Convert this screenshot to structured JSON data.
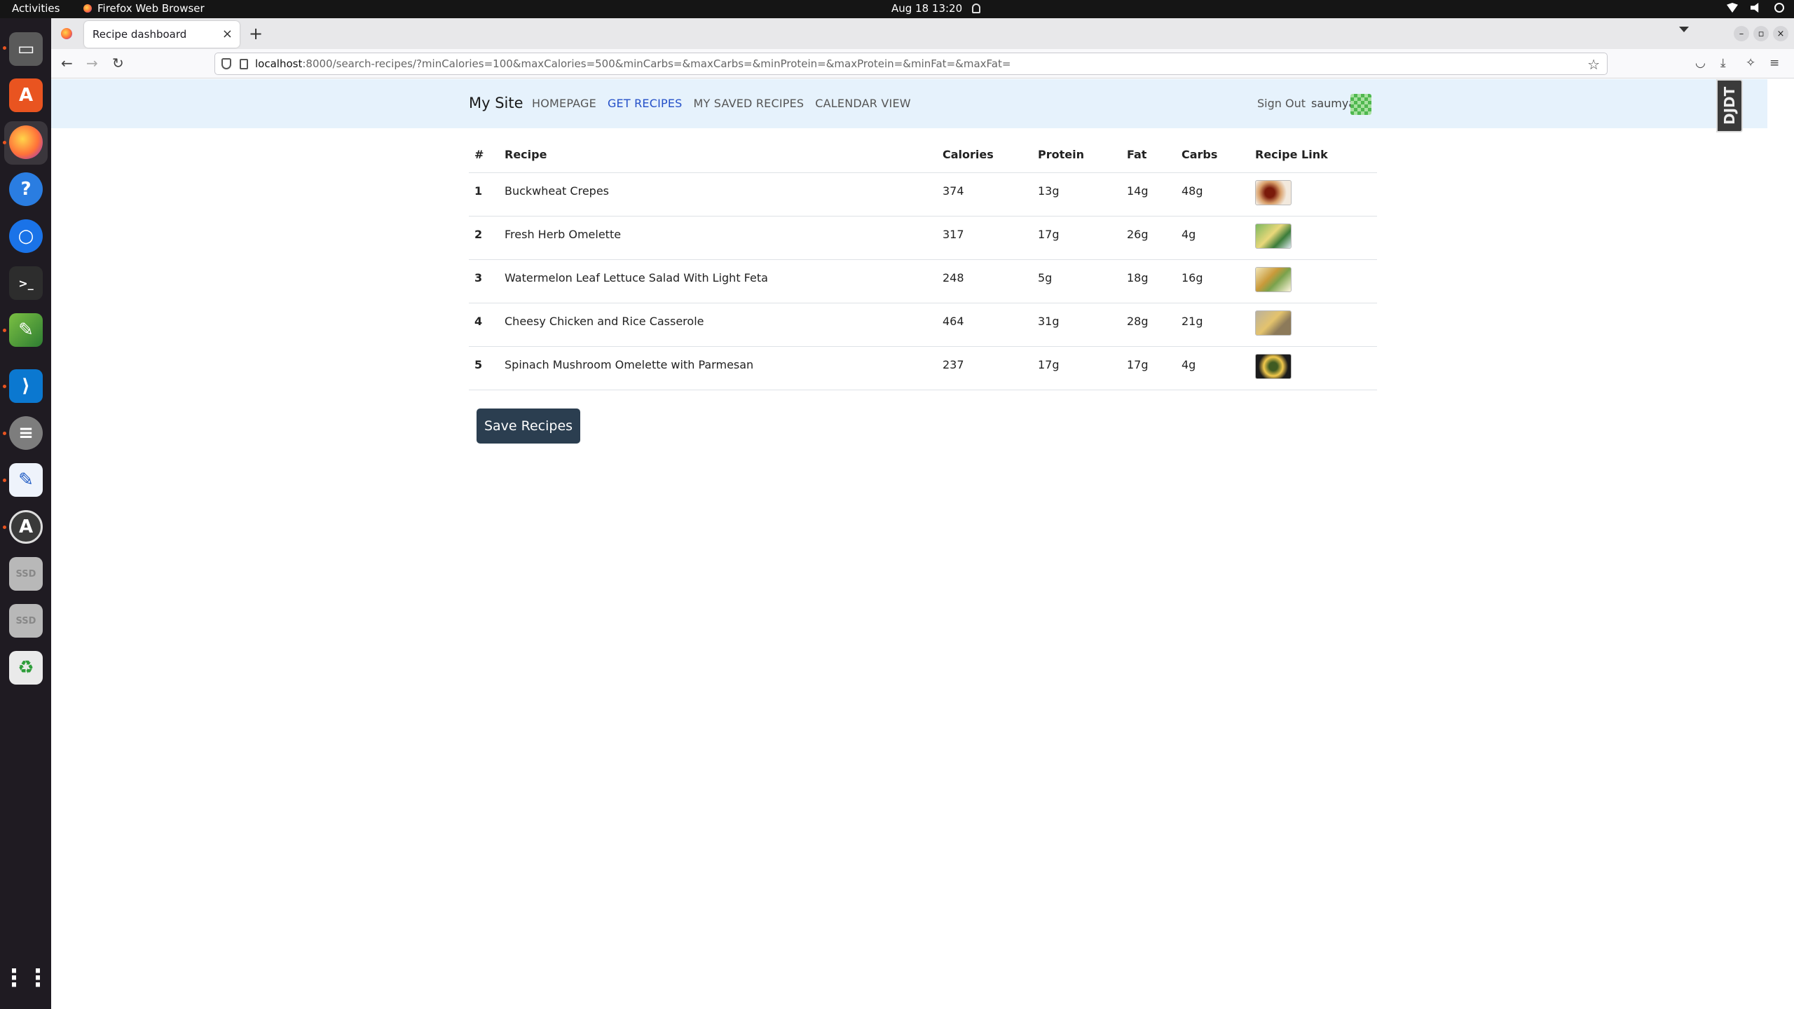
{
  "system": {
    "activities": "Activities",
    "app_name": "Firefox Web Browser",
    "clock": "Aug 18  13:20"
  },
  "browser": {
    "tab_title": "Recipe dashboard",
    "url_host": "localhost",
    "url_rest": ":8000/search-recipes/?minCalories=100&maxCalories=500&minCarbs=&maxCarbs=&minProtein=&maxProtein=&minFat=&maxFat="
  },
  "site": {
    "brand": "My Site",
    "nav": [
      "HOMEPAGE",
      "GET RECIPES",
      "MY SAVED RECIPES",
      "CALENDAR VIEW"
    ],
    "active_nav": "GET RECIPES",
    "sign_out": "Sign Out",
    "username": "saumya",
    "debug_toolbar": "DJDT"
  },
  "table": {
    "headers": [
      "#",
      "Recipe",
      "Calories",
      "Protein",
      "Fat",
      "Carbs",
      "Recipe Link"
    ],
    "rows": [
      {
        "num": "1",
        "recipe": "Buckwheat Crepes",
        "calories": "374",
        "protein": "13g",
        "fat": "14g",
        "carbs": "48g"
      },
      {
        "num": "2",
        "recipe": "Fresh Herb Omelette",
        "calories": "317",
        "protein": "17g",
        "fat": "26g",
        "carbs": "4g"
      },
      {
        "num": "3",
        "recipe": "Watermelon Leaf Lettuce Salad With Light Feta",
        "calories": "248",
        "protein": "5g",
        "fat": "18g",
        "carbs": "16g"
      },
      {
        "num": "4",
        "recipe": "Cheesy Chicken and Rice Casserole",
        "calories": "464",
        "protein": "31g",
        "fat": "28g",
        "carbs": "21g"
      },
      {
        "num": "5",
        "recipe": "Spinach Mushroom Omelette with Parmesan",
        "calories": "237",
        "protein": "17g",
        "fat": "17g",
        "carbs": "4g"
      }
    ]
  },
  "actions": {
    "save_label": "Save Recipes"
  },
  "colors": {
    "nav_bg": "#e6f2fc",
    "active_link": "#2450c8",
    "button_bg": "#2b3e50"
  }
}
